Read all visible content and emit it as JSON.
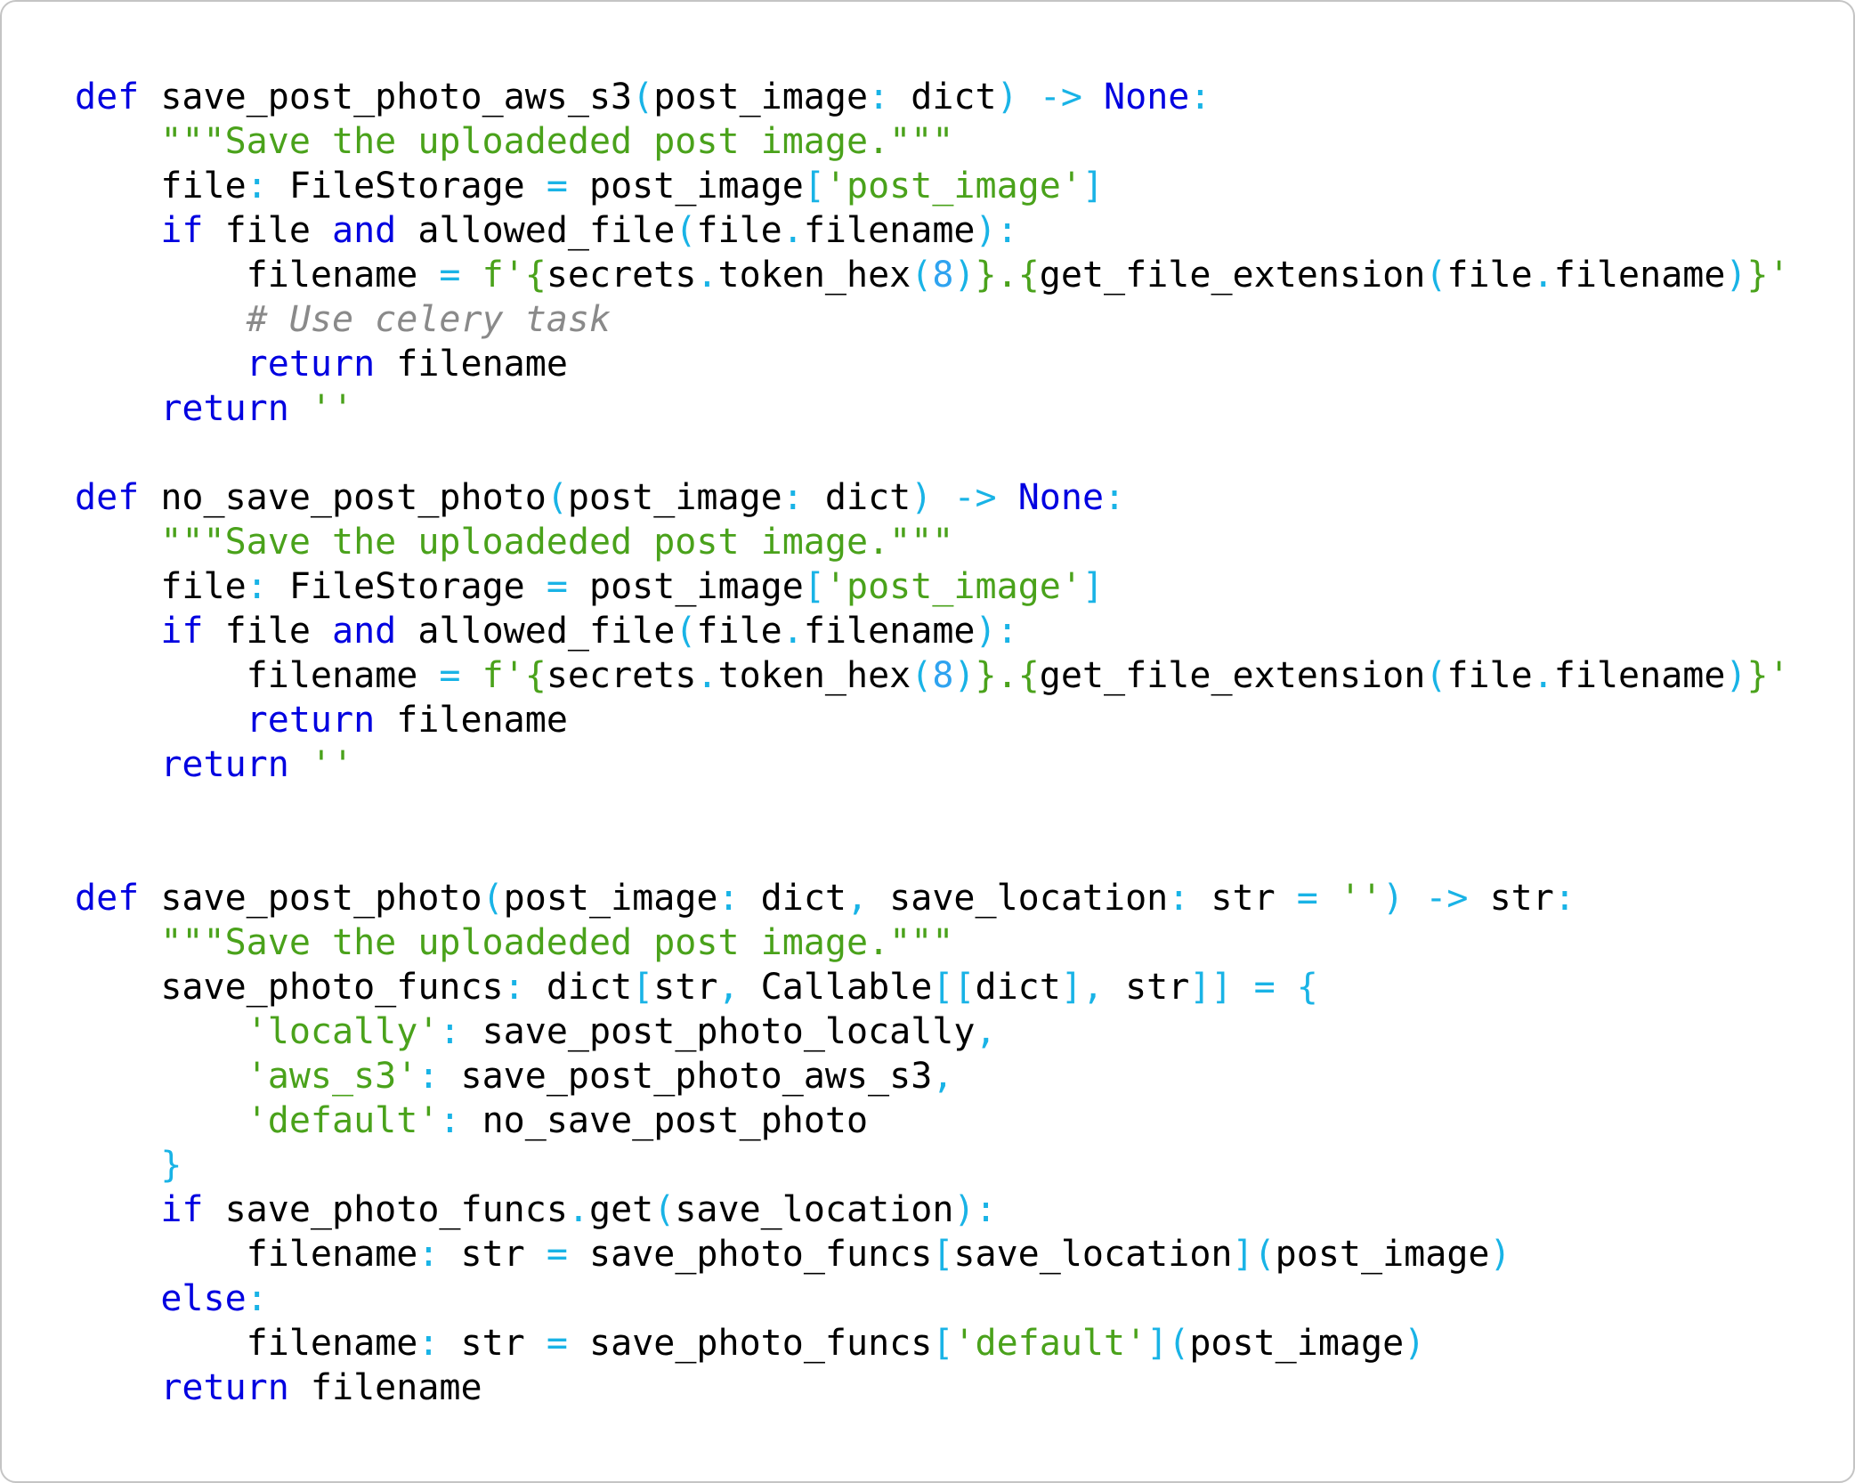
{
  "colors": {
    "keyword": "#0000e0",
    "string": "#4aa21b",
    "operator": "#19b3e6",
    "number": "#2fa3f0",
    "comment": "#8a8a8a",
    "text": "#000000",
    "border": "#c4c4c4",
    "background": "#ffffff"
  },
  "code_lines": [
    [
      [
        "kw",
        "def"
      ],
      [
        "n",
        " save_post_photo_aws_s3"
      ],
      [
        "op",
        "("
      ],
      [
        "n",
        "post_image"
      ],
      [
        "op",
        ":"
      ],
      [
        "n",
        " dict"
      ],
      [
        "op",
        ")"
      ],
      [
        "n",
        " "
      ],
      [
        "op",
        "->"
      ],
      [
        "n",
        " "
      ],
      [
        "kw",
        "None"
      ],
      [
        "op",
        ":"
      ]
    ],
    [
      [
        "n",
        "    "
      ],
      [
        "str",
        "\"\"\"Save the uploadeded post image.\"\"\""
      ]
    ],
    [
      [
        "n",
        "    file"
      ],
      [
        "op",
        ":"
      ],
      [
        "n",
        " FileStorage "
      ],
      [
        "op",
        "="
      ],
      [
        "n",
        " post_image"
      ],
      [
        "op",
        "["
      ],
      [
        "str",
        "'post_image'"
      ],
      [
        "op",
        "]"
      ]
    ],
    [
      [
        "n",
        "    "
      ],
      [
        "kw",
        "if"
      ],
      [
        "n",
        " file "
      ],
      [
        "kw",
        "and"
      ],
      [
        "n",
        " allowed_file"
      ],
      [
        "op",
        "("
      ],
      [
        "n",
        "file"
      ],
      [
        "op",
        "."
      ],
      [
        "n",
        "filename"
      ],
      [
        "op",
        "):"
      ]
    ],
    [
      [
        "n",
        "        filename "
      ],
      [
        "op",
        "="
      ],
      [
        "n",
        " "
      ],
      [
        "str",
        "f'{"
      ],
      [
        "n",
        "secrets"
      ],
      [
        "op",
        "."
      ],
      [
        "n",
        "token_hex"
      ],
      [
        "op",
        "("
      ],
      [
        "num",
        "8"
      ],
      [
        "op",
        ")"
      ],
      [
        "str",
        "}.{"
      ],
      [
        "n",
        "get_file_extension"
      ],
      [
        "op",
        "("
      ],
      [
        "n",
        "file"
      ],
      [
        "op",
        "."
      ],
      [
        "n",
        "filename"
      ],
      [
        "op",
        ")"
      ],
      [
        "str",
        "}'"
      ]
    ],
    [
      [
        "n",
        "        "
      ],
      [
        "cm",
        "# Use celery task"
      ]
    ],
    [
      [
        "n",
        "        "
      ],
      [
        "kw",
        "return"
      ],
      [
        "n",
        " filename"
      ]
    ],
    [
      [
        "n",
        "    "
      ],
      [
        "kw",
        "return"
      ],
      [
        "n",
        " "
      ],
      [
        "str",
        "''"
      ]
    ],
    [],
    [
      [
        "kw",
        "def"
      ],
      [
        "n",
        " no_save_post_photo"
      ],
      [
        "op",
        "("
      ],
      [
        "n",
        "post_image"
      ],
      [
        "op",
        ":"
      ],
      [
        "n",
        " dict"
      ],
      [
        "op",
        ")"
      ],
      [
        "n",
        " "
      ],
      [
        "op",
        "->"
      ],
      [
        "n",
        " "
      ],
      [
        "kw",
        "None"
      ],
      [
        "op",
        ":"
      ]
    ],
    [
      [
        "n",
        "    "
      ],
      [
        "str",
        "\"\"\"Save the uploadeded post image.\"\"\""
      ]
    ],
    [
      [
        "n",
        "    file"
      ],
      [
        "op",
        ":"
      ],
      [
        "n",
        " FileStorage "
      ],
      [
        "op",
        "="
      ],
      [
        "n",
        " post_image"
      ],
      [
        "op",
        "["
      ],
      [
        "str",
        "'post_image'"
      ],
      [
        "op",
        "]"
      ]
    ],
    [
      [
        "n",
        "    "
      ],
      [
        "kw",
        "if"
      ],
      [
        "n",
        " file "
      ],
      [
        "kw",
        "and"
      ],
      [
        "n",
        " allowed_file"
      ],
      [
        "op",
        "("
      ],
      [
        "n",
        "file"
      ],
      [
        "op",
        "."
      ],
      [
        "n",
        "filename"
      ],
      [
        "op",
        "):"
      ]
    ],
    [
      [
        "n",
        "        filename "
      ],
      [
        "op",
        "="
      ],
      [
        "n",
        " "
      ],
      [
        "str",
        "f'{"
      ],
      [
        "n",
        "secrets"
      ],
      [
        "op",
        "."
      ],
      [
        "n",
        "token_hex"
      ],
      [
        "op",
        "("
      ],
      [
        "num",
        "8"
      ],
      [
        "op",
        ")"
      ],
      [
        "str",
        "}.{"
      ],
      [
        "n",
        "get_file_extension"
      ],
      [
        "op",
        "("
      ],
      [
        "n",
        "file"
      ],
      [
        "op",
        "."
      ],
      [
        "n",
        "filename"
      ],
      [
        "op",
        ")"
      ],
      [
        "str",
        "}'"
      ]
    ],
    [
      [
        "n",
        "        "
      ],
      [
        "kw",
        "return"
      ],
      [
        "n",
        " filename"
      ]
    ],
    [
      [
        "n",
        "    "
      ],
      [
        "kw",
        "return"
      ],
      [
        "n",
        " "
      ],
      [
        "str",
        "''"
      ]
    ],
    [],
    [],
    [
      [
        "kw",
        "def"
      ],
      [
        "n",
        " save_post_photo"
      ],
      [
        "op",
        "("
      ],
      [
        "n",
        "post_image"
      ],
      [
        "op",
        ":"
      ],
      [
        "n",
        " dict"
      ],
      [
        "op",
        ","
      ],
      [
        "n",
        " save_location"
      ],
      [
        "op",
        ":"
      ],
      [
        "n",
        " str "
      ],
      [
        "op",
        "="
      ],
      [
        "n",
        " "
      ],
      [
        "str",
        "''"
      ],
      [
        "op",
        ")"
      ],
      [
        "n",
        " "
      ],
      [
        "op",
        "->"
      ],
      [
        "n",
        " str"
      ],
      [
        "op",
        ":"
      ]
    ],
    [
      [
        "n",
        "    "
      ],
      [
        "str",
        "\"\"\"Save the uploadeded post image.\"\"\""
      ]
    ],
    [
      [
        "n",
        "    save_photo_funcs"
      ],
      [
        "op",
        ":"
      ],
      [
        "n",
        " dict"
      ],
      [
        "op",
        "["
      ],
      [
        "n",
        "str"
      ],
      [
        "op",
        ","
      ],
      [
        "n",
        " Callable"
      ],
      [
        "op",
        "[["
      ],
      [
        "n",
        "dict"
      ],
      [
        "op",
        "],"
      ],
      [
        "n",
        " str"
      ],
      [
        "op",
        "]]"
      ],
      [
        "n",
        " "
      ],
      [
        "op",
        "="
      ],
      [
        "n",
        " "
      ],
      [
        "op",
        "{"
      ]
    ],
    [
      [
        "n",
        "        "
      ],
      [
        "str",
        "'locally'"
      ],
      [
        "op",
        ":"
      ],
      [
        "n",
        " save_post_photo_locally"
      ],
      [
        "op",
        ","
      ]
    ],
    [
      [
        "n",
        "        "
      ],
      [
        "str",
        "'aws_s3'"
      ],
      [
        "op",
        ":"
      ],
      [
        "n",
        " save_post_photo_aws_s3"
      ],
      [
        "op",
        ","
      ]
    ],
    [
      [
        "n",
        "        "
      ],
      [
        "str",
        "'default'"
      ],
      [
        "op",
        ":"
      ],
      [
        "n",
        " no_save_post_photo"
      ]
    ],
    [
      [
        "n",
        "    "
      ],
      [
        "op",
        "}"
      ]
    ],
    [
      [
        "n",
        "    "
      ],
      [
        "kw",
        "if"
      ],
      [
        "n",
        " save_photo_funcs"
      ],
      [
        "op",
        "."
      ],
      [
        "n",
        "get"
      ],
      [
        "op",
        "("
      ],
      [
        "n",
        "save_location"
      ],
      [
        "op",
        "):"
      ]
    ],
    [
      [
        "n",
        "        filename"
      ],
      [
        "op",
        ":"
      ],
      [
        "n",
        " str "
      ],
      [
        "op",
        "="
      ],
      [
        "n",
        " save_photo_funcs"
      ],
      [
        "op",
        "["
      ],
      [
        "n",
        "save_location"
      ],
      [
        "op",
        "]("
      ],
      [
        "n",
        "post_image"
      ],
      [
        "op",
        ")"
      ]
    ],
    [
      [
        "n",
        "    "
      ],
      [
        "kw",
        "else"
      ],
      [
        "op",
        ":"
      ]
    ],
    [
      [
        "n",
        "        filename"
      ],
      [
        "op",
        ":"
      ],
      [
        "n",
        " str "
      ],
      [
        "op",
        "="
      ],
      [
        "n",
        " save_photo_funcs"
      ],
      [
        "op",
        "["
      ],
      [
        "str",
        "'default'"
      ],
      [
        "op",
        "]("
      ],
      [
        "n",
        "post_image"
      ],
      [
        "op",
        ")"
      ]
    ],
    [
      [
        "n",
        "    "
      ],
      [
        "kw",
        "return"
      ],
      [
        "n",
        " filename"
      ]
    ]
  ]
}
